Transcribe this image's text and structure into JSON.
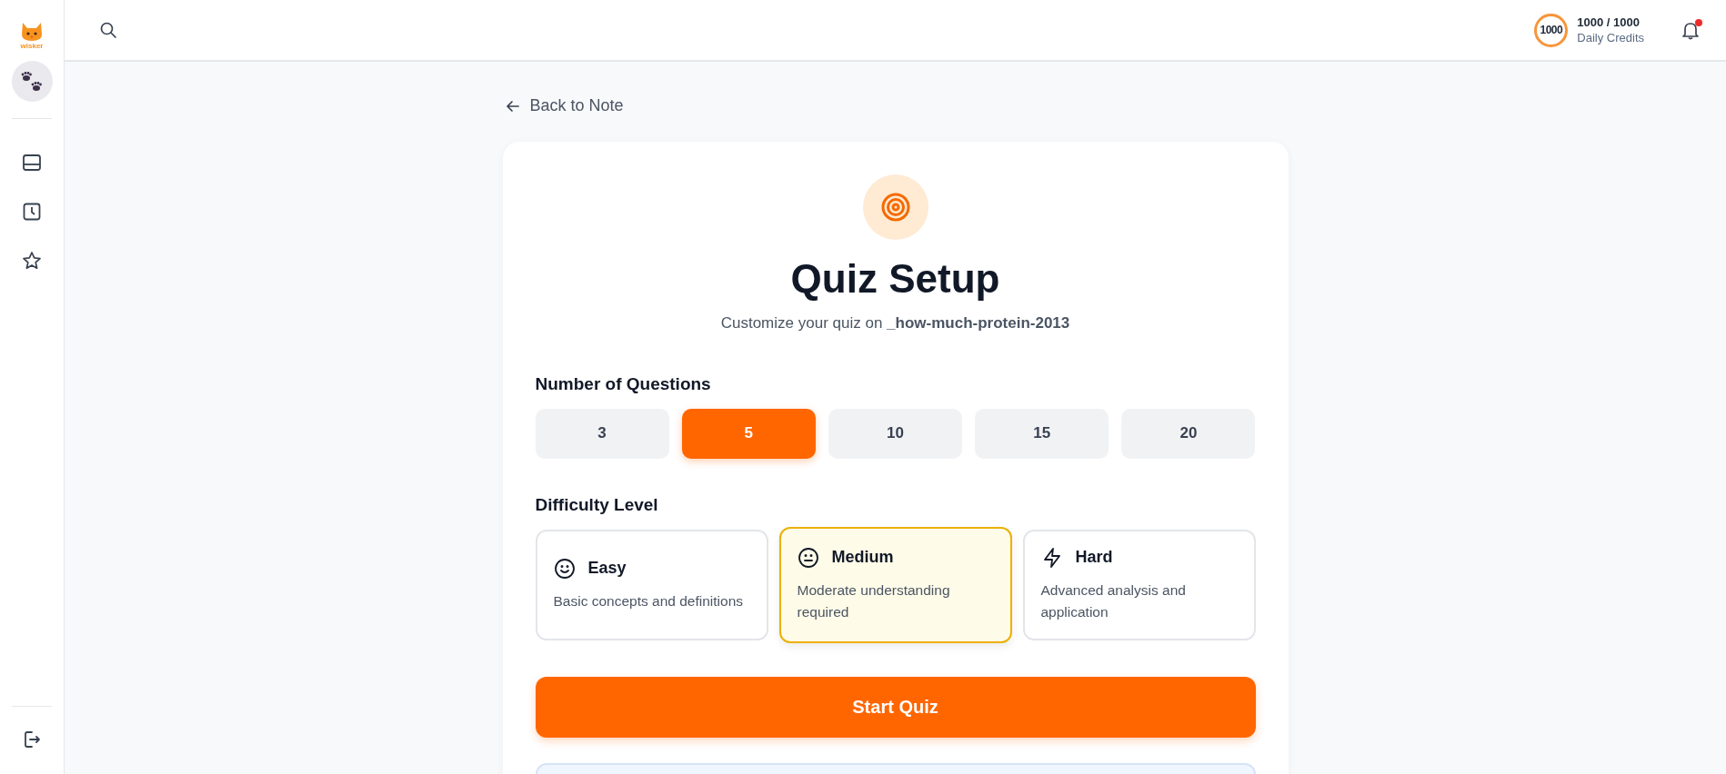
{
  "sidebar": {
    "logo_text": "wisker",
    "nav": [
      {
        "kind": "panel",
        "selected": false
      },
      {
        "kind": "history",
        "selected": false
      },
      {
        "kind": "favorites",
        "selected": false
      }
    ]
  },
  "topbar": {
    "credits_badge": "1000",
    "credits": "1000 / 1000",
    "credits_label": "Daily Credits",
    "notification": true
  },
  "back_link": "Back to Note",
  "title": "Quiz Setup",
  "subtitle": "Customize your quiz on **_how-much-protein-2013**",
  "questions": {
    "label": "Number of Questions",
    "options": [
      {
        "label": "3",
        "selected": false
      },
      {
        "label": "5",
        "selected": true
      },
      {
        "label": "10",
        "selected": false
      },
      {
        "label": "15",
        "selected": false
      },
      {
        "label": "20",
        "selected": false
      }
    ]
  },
  "difficulty": {
    "label": "Difficulty Level",
    "options": [
      {
        "kind": "easy",
        "label": "Easy",
        "description": "Basic concepts and definitions",
        "selected": false
      },
      {
        "kind": "medium",
        "label": "Medium",
        "description": "Moderate understanding required",
        "selected": true
      },
      {
        "kind": "hard",
        "label": "Hard",
        "description": "Advanced analysis and application",
        "selected": false
      }
    ]
  },
  "start_button": "Start Quiz"
}
